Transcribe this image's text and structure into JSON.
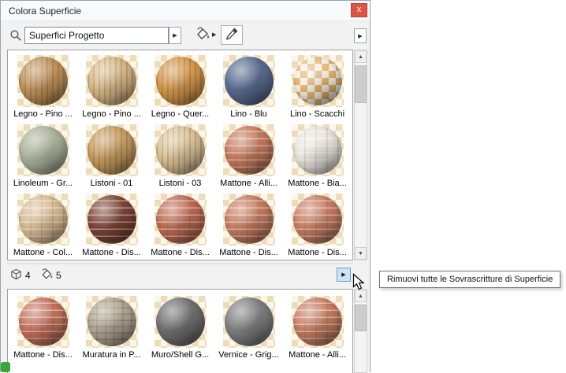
{
  "window": {
    "title": "Colora Superficie",
    "close_glyph": "x"
  },
  "toolbar": {
    "search_value": "Superfici Progetto",
    "icons": {
      "search": "magnifier-icon",
      "paint_bucket": "paint-bucket-icon",
      "eyedropper": "eyedropper-icon"
    }
  },
  "icons": {
    "arrow_right": "▶",
    "arrow_up": "▲",
    "arrow_down": "▼"
  },
  "status": {
    "surface_count": "4",
    "override_count": "5"
  },
  "tooltip": {
    "text": "Rimuovi tutte le Sovrascritture di Superficie"
  },
  "top_panel": {
    "items": [
      {
        "label": "Legno - Pino ...",
        "color": "#c1945c",
        "texture": "wood"
      },
      {
        "label": "Legno - Pino ...",
        "color": "#d9ba8a",
        "texture": "wood"
      },
      {
        "label": "Legno - Quer...",
        "color": "#d69a50",
        "texture": "wood"
      },
      {
        "label": "Lino - Blu",
        "color": "#5a6b90",
        "texture": "plain"
      },
      {
        "label": "Lino - Scacchi",
        "color": "#f6efdf",
        "texture": "checker"
      },
      {
        "label": "Linoleum - Gr...",
        "color": "#a9b29a",
        "texture": "plain"
      },
      {
        "label": "Listoni - 01",
        "color": "#c89e62",
        "texture": "wood"
      },
      {
        "label": "Listoni - 03",
        "color": "#ddc49b",
        "texture": "wood"
      },
      {
        "label": "Mattone - Alli...",
        "color": "#c5795c",
        "texture": "brick"
      },
      {
        "label": "Mattone - Bia...",
        "color": "#e8e4dc",
        "texture": "brick"
      },
      {
        "label": "Mattone - Col...",
        "color": "#d8ba92",
        "texture": "brick"
      },
      {
        "label": "Mattone - Dis...",
        "color": "#7c4335",
        "texture": "brick"
      },
      {
        "label": "Mattone - Dis...",
        "color": "#bd6950",
        "texture": "brick"
      },
      {
        "label": "Mattone - Dis...",
        "color": "#c67b5e",
        "texture": "brick"
      },
      {
        "label": "Mattone - Dis...",
        "color": "#c87c62",
        "texture": "brick"
      }
    ]
  },
  "bottom_panel": {
    "items": [
      {
        "label": "Mattone - Dis...",
        "color": "#c4705a",
        "texture": "brick"
      },
      {
        "label": "Muratura in P...",
        "color": "#b2a794",
        "texture": "stone"
      },
      {
        "label": "Muro/Shell G...",
        "color": "#6f6f6f",
        "texture": "plain"
      },
      {
        "label": "Vernice - Grig...",
        "color": "#7e7e7e",
        "texture": "plain"
      },
      {
        "label": "Mattone - Alli...",
        "color": "#c77c60",
        "texture": "brick"
      }
    ]
  }
}
